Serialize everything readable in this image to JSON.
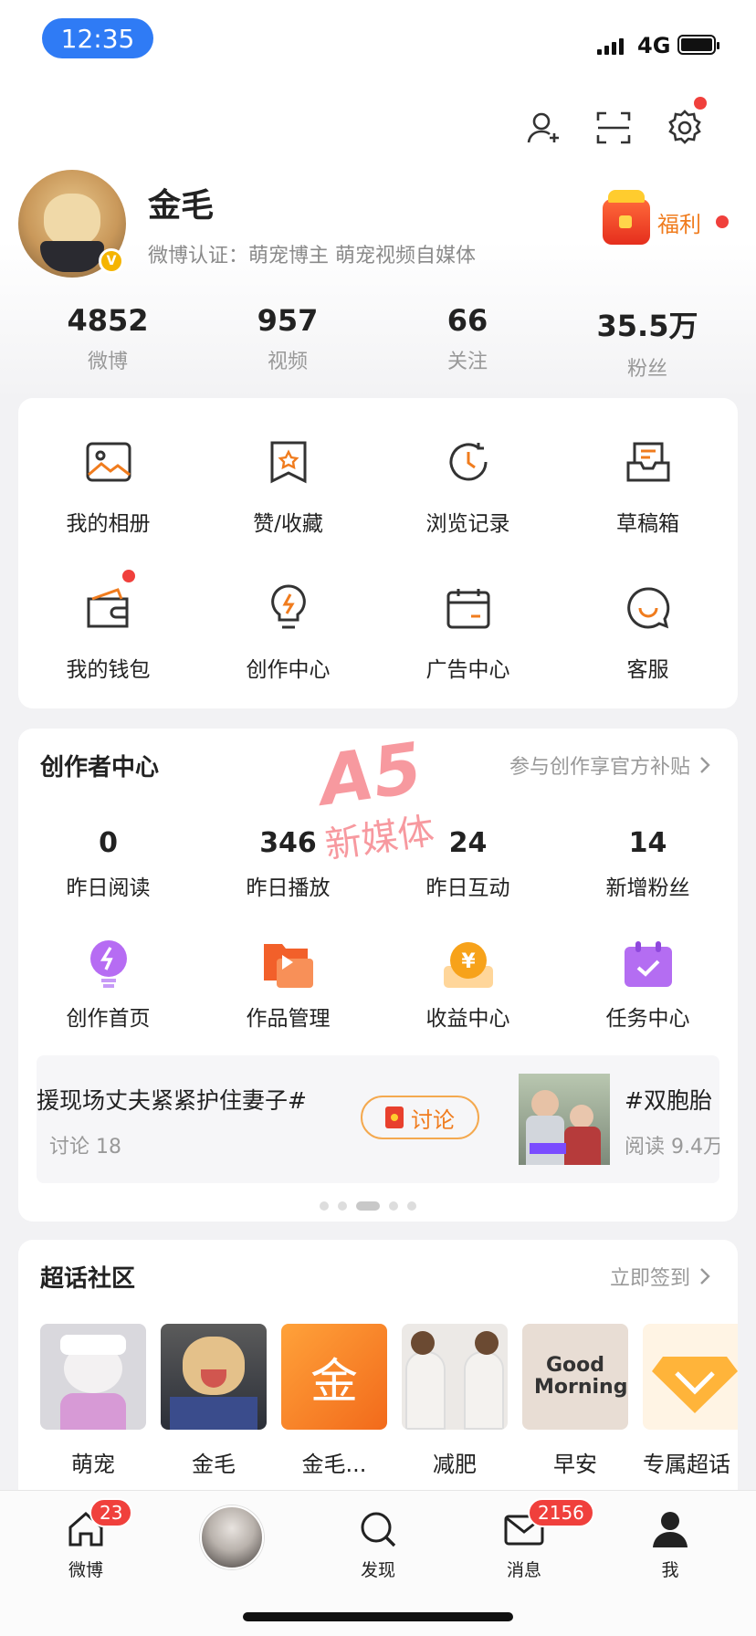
{
  "status_bar": {
    "time": "12:35",
    "network": "4G"
  },
  "profile": {
    "name": "金毛",
    "certification": "微博认证：萌宠博主 萌宠视频自媒体",
    "welfare_label": "福利",
    "verified_badge": "V"
  },
  "stats": [
    {
      "value": "4852",
      "label": "微博"
    },
    {
      "value": "957",
      "label": "视频"
    },
    {
      "value": "66",
      "label": "关注"
    },
    {
      "value": "35.5万",
      "label": "粉丝"
    }
  ],
  "tools": [
    {
      "label": "我的相册",
      "icon": "photo-album-icon"
    },
    {
      "label": "赞/收藏",
      "icon": "favorites-icon"
    },
    {
      "label": "浏览记录",
      "icon": "history-icon"
    },
    {
      "label": "草稿箱",
      "icon": "drafts-icon"
    },
    {
      "label": "我的钱包",
      "icon": "wallet-icon"
    },
    {
      "label": "创作中心",
      "icon": "lightbulb-icon"
    },
    {
      "label": "广告中心",
      "icon": "calendar-icon"
    },
    {
      "label": "客服",
      "icon": "customer-service-icon"
    }
  ],
  "creator_center": {
    "title": "创作者中心",
    "link": "参与创作享官方补贴",
    "stats": [
      {
        "value": "0",
        "label": "昨日阅读"
      },
      {
        "value": "346",
        "label": "昨日播放"
      },
      {
        "value": "24",
        "label": "昨日互动"
      },
      {
        "value": "14",
        "label": "新增粉丝"
      }
    ],
    "entries": [
      {
        "label": "创作首页",
        "icon": "bolt-bulb-icon"
      },
      {
        "label": "作品管理",
        "icon": "video-manage-icon"
      },
      {
        "label": "收益中心",
        "icon": "yen-coin-icon"
      },
      {
        "label": "任务中心",
        "icon": "task-calendar-icon"
      }
    ],
    "banner": {
      "left_title": "援现场丈夫紧紧护住妻子#",
      "left_sub": "讨论 18",
      "button": "讨论",
      "right_title": "#双胞胎",
      "right_sub": "阅读 9.4万"
    }
  },
  "super_topic": {
    "title": "超话社区",
    "link": "立即签到",
    "items": [
      {
        "label": "萌宠"
      },
      {
        "label": "金毛"
      },
      {
        "label": "金毛...",
        "glyph": "金"
      },
      {
        "label": "减肥"
      },
      {
        "label": "早安",
        "glyph": "Good Morning"
      },
      {
        "label": "专属超话"
      }
    ]
  },
  "watermark": {
    "top": "A5",
    "bottom": "新媒体"
  },
  "tabbar": [
    {
      "label": "微博",
      "badge": "23"
    },
    {
      "label": "",
      "badge": ""
    },
    {
      "label": "发现",
      "badge": ""
    },
    {
      "label": "消息",
      "badge": "2156"
    },
    {
      "label": "我",
      "badge": ""
    }
  ],
  "colors": {
    "accent": "#f07c1e",
    "status_blue": "#2f7bf5",
    "badge_red": "#f0403c"
  }
}
